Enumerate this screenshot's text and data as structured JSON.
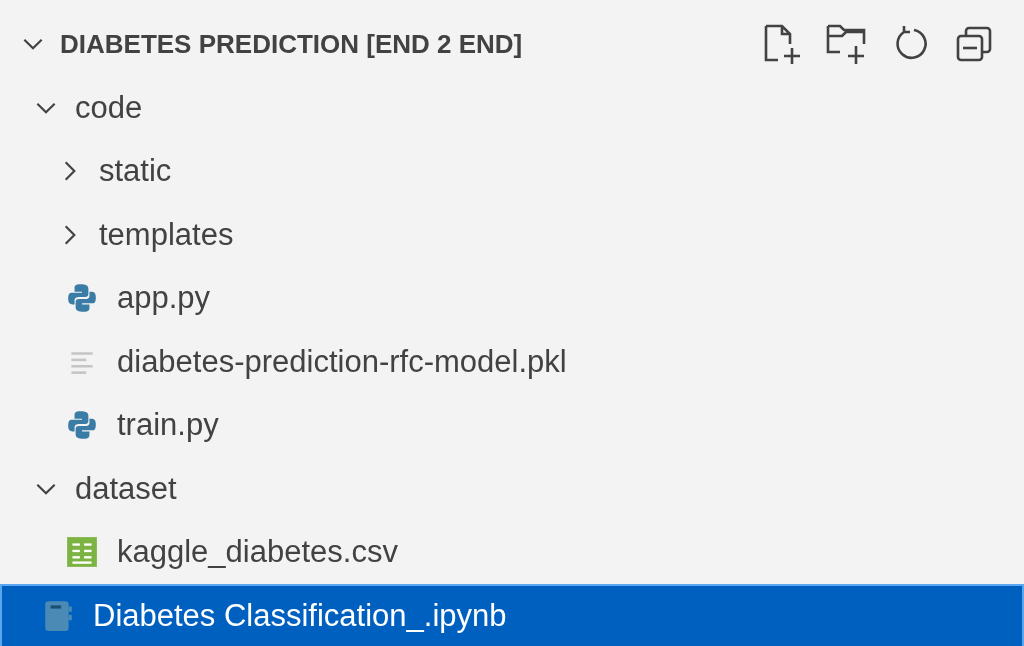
{
  "explorer": {
    "title": "DIABETES PREDICTION [END 2 END]",
    "expanded": true,
    "tree": [
      {
        "label": "code",
        "kind": "folder",
        "expanded": true,
        "selected": false,
        "children": [
          {
            "label": "static",
            "kind": "folder",
            "expanded": false,
            "selected": false
          },
          {
            "label": "templates",
            "kind": "folder",
            "expanded": false,
            "selected": false
          },
          {
            "label": "app.py",
            "kind": "python",
            "selected": false
          },
          {
            "label": "diabetes-prediction-rfc-model.pkl",
            "kind": "text",
            "selected": false
          },
          {
            "label": "train.py",
            "kind": "python",
            "selected": false
          }
        ]
      },
      {
        "label": "dataset",
        "kind": "folder",
        "expanded": true,
        "selected": false,
        "children": [
          {
            "label": "kaggle_diabetes.csv",
            "kind": "spreadsheet",
            "selected": false
          }
        ]
      },
      {
        "label": "Diabetes Classification_.ipynb",
        "kind": "notebook",
        "selected": true
      }
    ]
  }
}
